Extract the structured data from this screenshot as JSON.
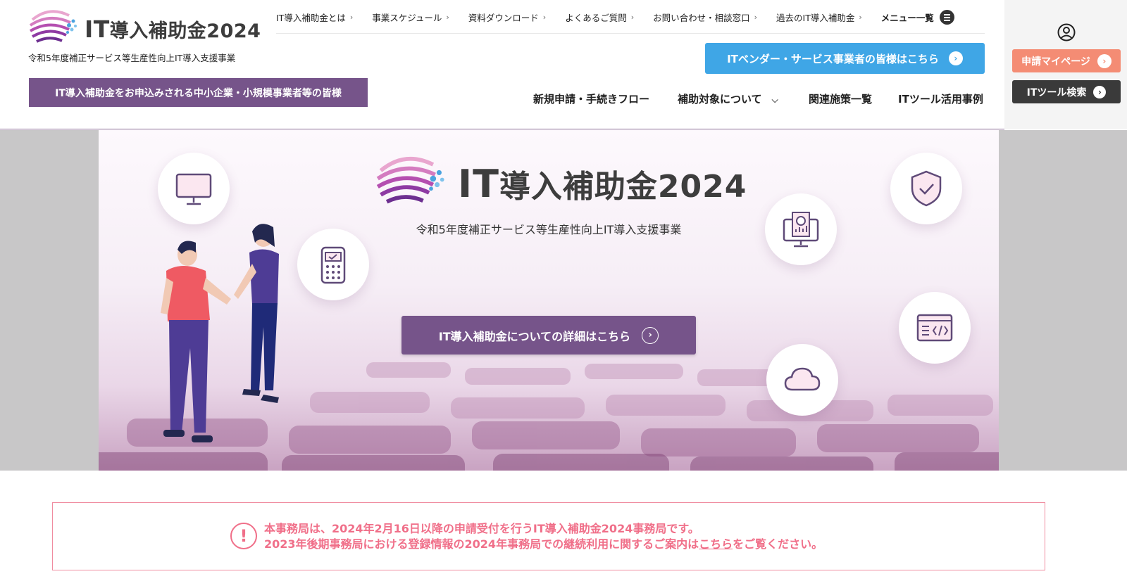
{
  "brand": {
    "title_it": "IT",
    "title_rest": "導入補助金2024",
    "subtitle": "令和5年度補正サービス等生産性向上IT導入支援事業"
  },
  "audience_badge": "IT導入補助金をお申込みされる中小企業・小規模事業者等の皆様",
  "top_nav": {
    "items": [
      {
        "label": "IT導入補助金とは"
      },
      {
        "label": "事業スケジュール"
      },
      {
        "label": "資料ダウンロード"
      },
      {
        "label": "よくあるご質問"
      },
      {
        "label": "お問い合わせ・相談窓口"
      },
      {
        "label": "過去のIT導入補助金"
      }
    ],
    "menu_all": "メニュー一覧"
  },
  "vendor_button": "ITベンダー・サービス事業者の皆様はこちら",
  "main_nav": {
    "flow": "新規申請・手続きフロー",
    "target": "補助対象について",
    "policies": "関連施策一覧",
    "cases": "ITツール活用事例"
  },
  "side": {
    "mypage": "申請マイページ",
    "tool_search": "ITツール検索"
  },
  "hero": {
    "title_it": "IT",
    "title_rest": "導入補助金2024",
    "subtitle": "令和5年度補正サービス等生産性向上IT導入支援事業",
    "cta": "IT導入補助金についての詳細はこちら"
  },
  "notice": {
    "line1": "本事務局は、2024年2月16日以降の申請受付を行うIT導入補助金2024事務局です。",
    "line2_pre": "2023年後期事務局における登録情報の2024年事務局での継続利用に関するご案内は",
    "line2_link": "こちら",
    "line2_post": "をご覧ください。"
  },
  "colors": {
    "brand_purple": "#76548a",
    "vendor_blue": "#3fa6e6",
    "mypage_coral": "#f48c74",
    "tool_dark": "#3a3a3a",
    "notice_pink": "#f06f89"
  },
  "icons": [
    "logo-globe-icon",
    "chevron-right-icon",
    "hamburger-icon",
    "user-circle-icon",
    "monitor-icon",
    "payment-terminal-icon",
    "shield-check-icon",
    "yen-monitor-icon",
    "code-window-icon",
    "cloud-icon",
    "exclamation-icon"
  ]
}
